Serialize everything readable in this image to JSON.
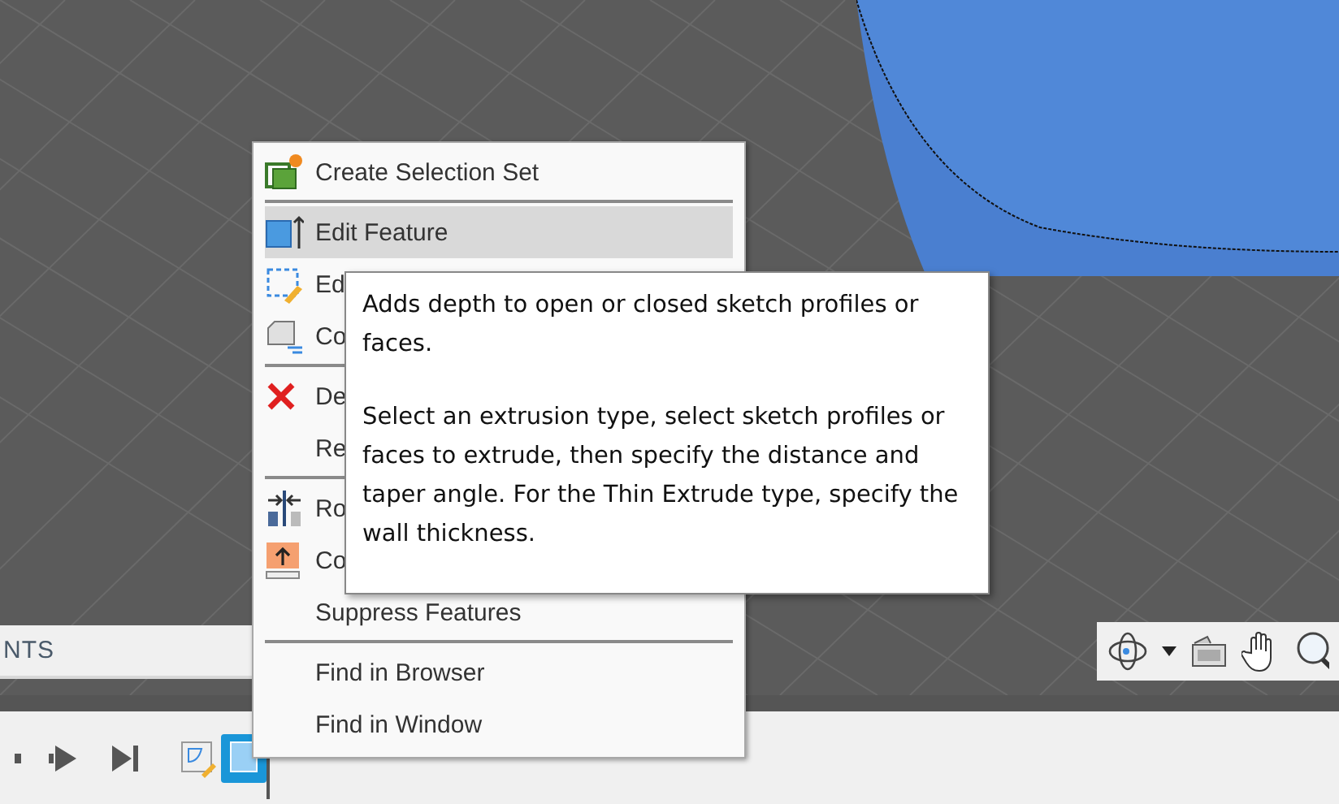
{
  "browser_panel": {
    "title": "NTS"
  },
  "context_menu": {
    "groups": [
      {
        "items": [
          {
            "label": "Create Selection Set",
            "selected": false
          }
        ]
      },
      {
        "items": [
          {
            "label": "Edit Feature",
            "selected": true
          },
          {
            "label": "Ed",
            "selected": false
          },
          {
            "label": "Co",
            "selected": false
          }
        ]
      },
      {
        "items": [
          {
            "label": "De",
            "selected": false
          },
          {
            "label": "Re",
            "selected": false
          }
        ]
      },
      {
        "items": [
          {
            "label": "Ro",
            "selected": false
          },
          {
            "label": "Co",
            "selected": false
          },
          {
            "label": "Suppress Features",
            "selected": false
          }
        ]
      },
      {
        "items": [
          {
            "label": "Find in Browser",
            "selected": false
          },
          {
            "label": "Find in Window",
            "selected": false
          }
        ]
      }
    ]
  },
  "tooltip": {
    "paragraphs": [
      "Adds depth to open or closed sketch profiles or faces.",
      "Select an extrusion type, select sketch profiles or faces to extrude, then specify the distance and taper angle. For the Thin Extrude type, specify the wall thickness."
    ]
  },
  "timeline": {
    "features": [
      {
        "kind": "sketch",
        "selected": false
      },
      {
        "kind": "extrude",
        "selected": true
      }
    ]
  }
}
